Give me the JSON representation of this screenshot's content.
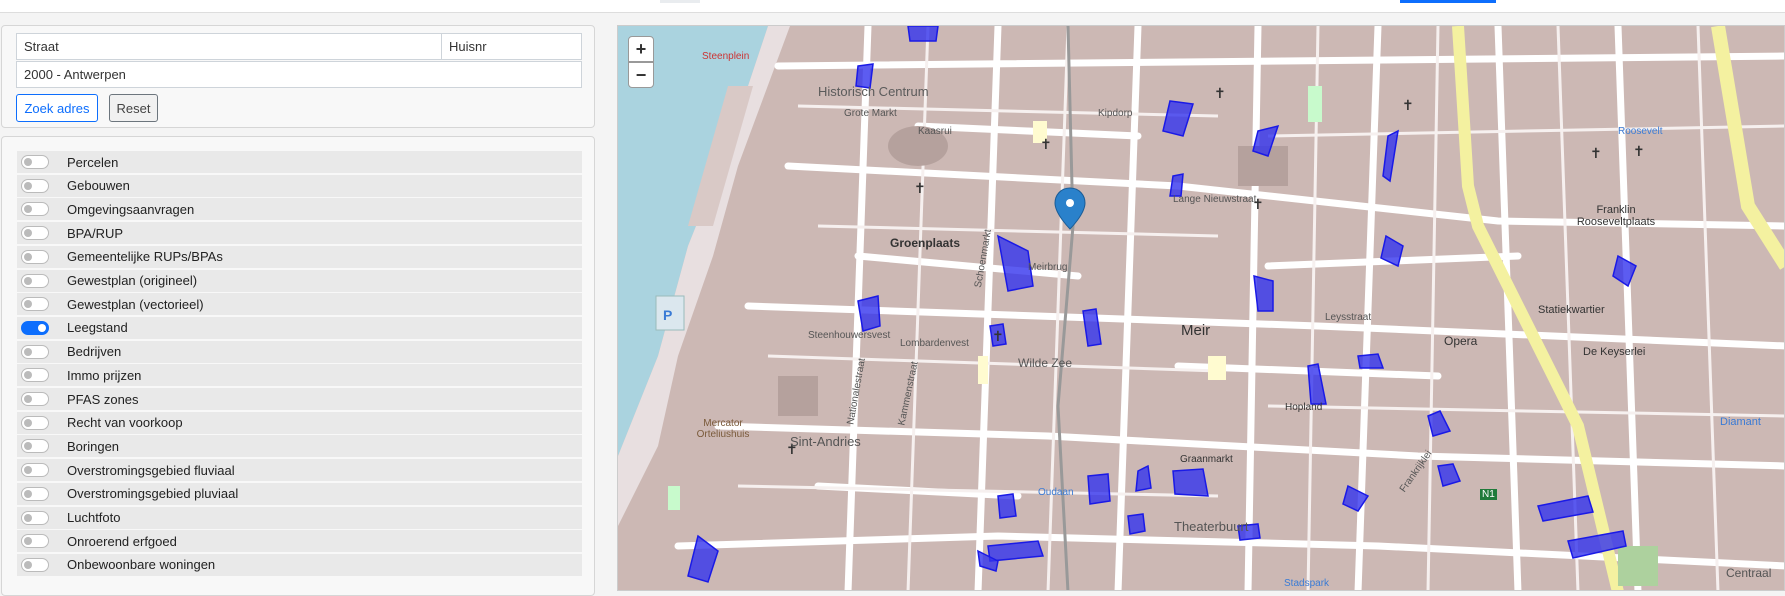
{
  "search": {
    "street_placeholder": "Straat",
    "housenr_placeholder": "Huisnr",
    "city_value": "2000 - Antwerpen",
    "search_button": "Zoek adres",
    "reset_button": "Reset"
  },
  "layers": [
    {
      "label": "Percelen",
      "on": false
    },
    {
      "label": "Gebouwen",
      "on": false
    },
    {
      "label": "Omgevingsaanvragen",
      "on": false
    },
    {
      "label": "BPA/RUP",
      "on": false
    },
    {
      "label": "Gemeentelijke RUPs/BPAs",
      "on": false
    },
    {
      "label": "Gewestplan (origineel)",
      "on": false
    },
    {
      "label": "Gewestplan (vectorieel)",
      "on": false
    },
    {
      "label": "Leegstand",
      "on": true
    },
    {
      "label": "Bedrijven",
      "on": false
    },
    {
      "label": "Immo prijzen",
      "on": false
    },
    {
      "label": "PFAS zones",
      "on": false
    },
    {
      "label": "Recht van voorkoop",
      "on": false
    },
    {
      "label": "Boringen",
      "on": false
    },
    {
      "label": "Overstromingsgebied fluviaal",
      "on": false
    },
    {
      "label": "Overstromingsgebied pluviaal",
      "on": false
    },
    {
      "label": "Luchtfoto",
      "on": false
    },
    {
      "label": "Onroerend erfgoed",
      "on": false
    },
    {
      "label": "Onbewoonbare woningen",
      "on": false
    }
  ],
  "map": {
    "zoom_in": "+",
    "zoom_out": "−",
    "labels": {
      "historisch_centrum": "Historisch Centrum",
      "groenplaats": "Groenplaats",
      "meir": "Meir",
      "wilde_zee": "Wilde Zee",
      "sint_andries": "Sint-Andries",
      "theaterbuurt": "Theaterbuurt",
      "opera": "Opera",
      "statiekwartier": "Statiekwartier",
      "franklin": "Franklin Rooseveltplaats",
      "de_keyserlei": "De Keyserlei",
      "steenplein": "Steenplein",
      "mercator": "Mercator Orteliushuis",
      "grote_markt": "Grote Markt",
      "oudaan": "Oudaan",
      "meirbrug": "Meirbrug",
      "leysstraat": "Leysstraat",
      "kipdorp": "Kipdorp",
      "lange_nieuwstraat": "Lange Nieuwstraat",
      "diamant": "Diamant",
      "centraal": "Centraal",
      "stadspark": "Stadspark",
      "graanmarkt": "Graanmarkt",
      "hopland": "Hopland",
      "schoenmarkt": "Schoenmarkt",
      "kaasrui": "Kaasrui",
      "kammenstraat": "Kammenstraat",
      "nationalestraat": "Nationalestraat",
      "lombardenvest": "Lombardenvest",
      "steenhouwersvest": "Steenhouwersvest",
      "frankrijklei": "Frankrijklei",
      "rooseveltplaats": "Roosevelt",
      "n1": "N1"
    }
  },
  "colors": {
    "accent": "#0d6efd",
    "vacancy_fill": "#3333ee",
    "building": "#cbb8b3",
    "road": "#ffffff",
    "water": "#aad3df",
    "river_bank": "#ccdfe8"
  }
}
